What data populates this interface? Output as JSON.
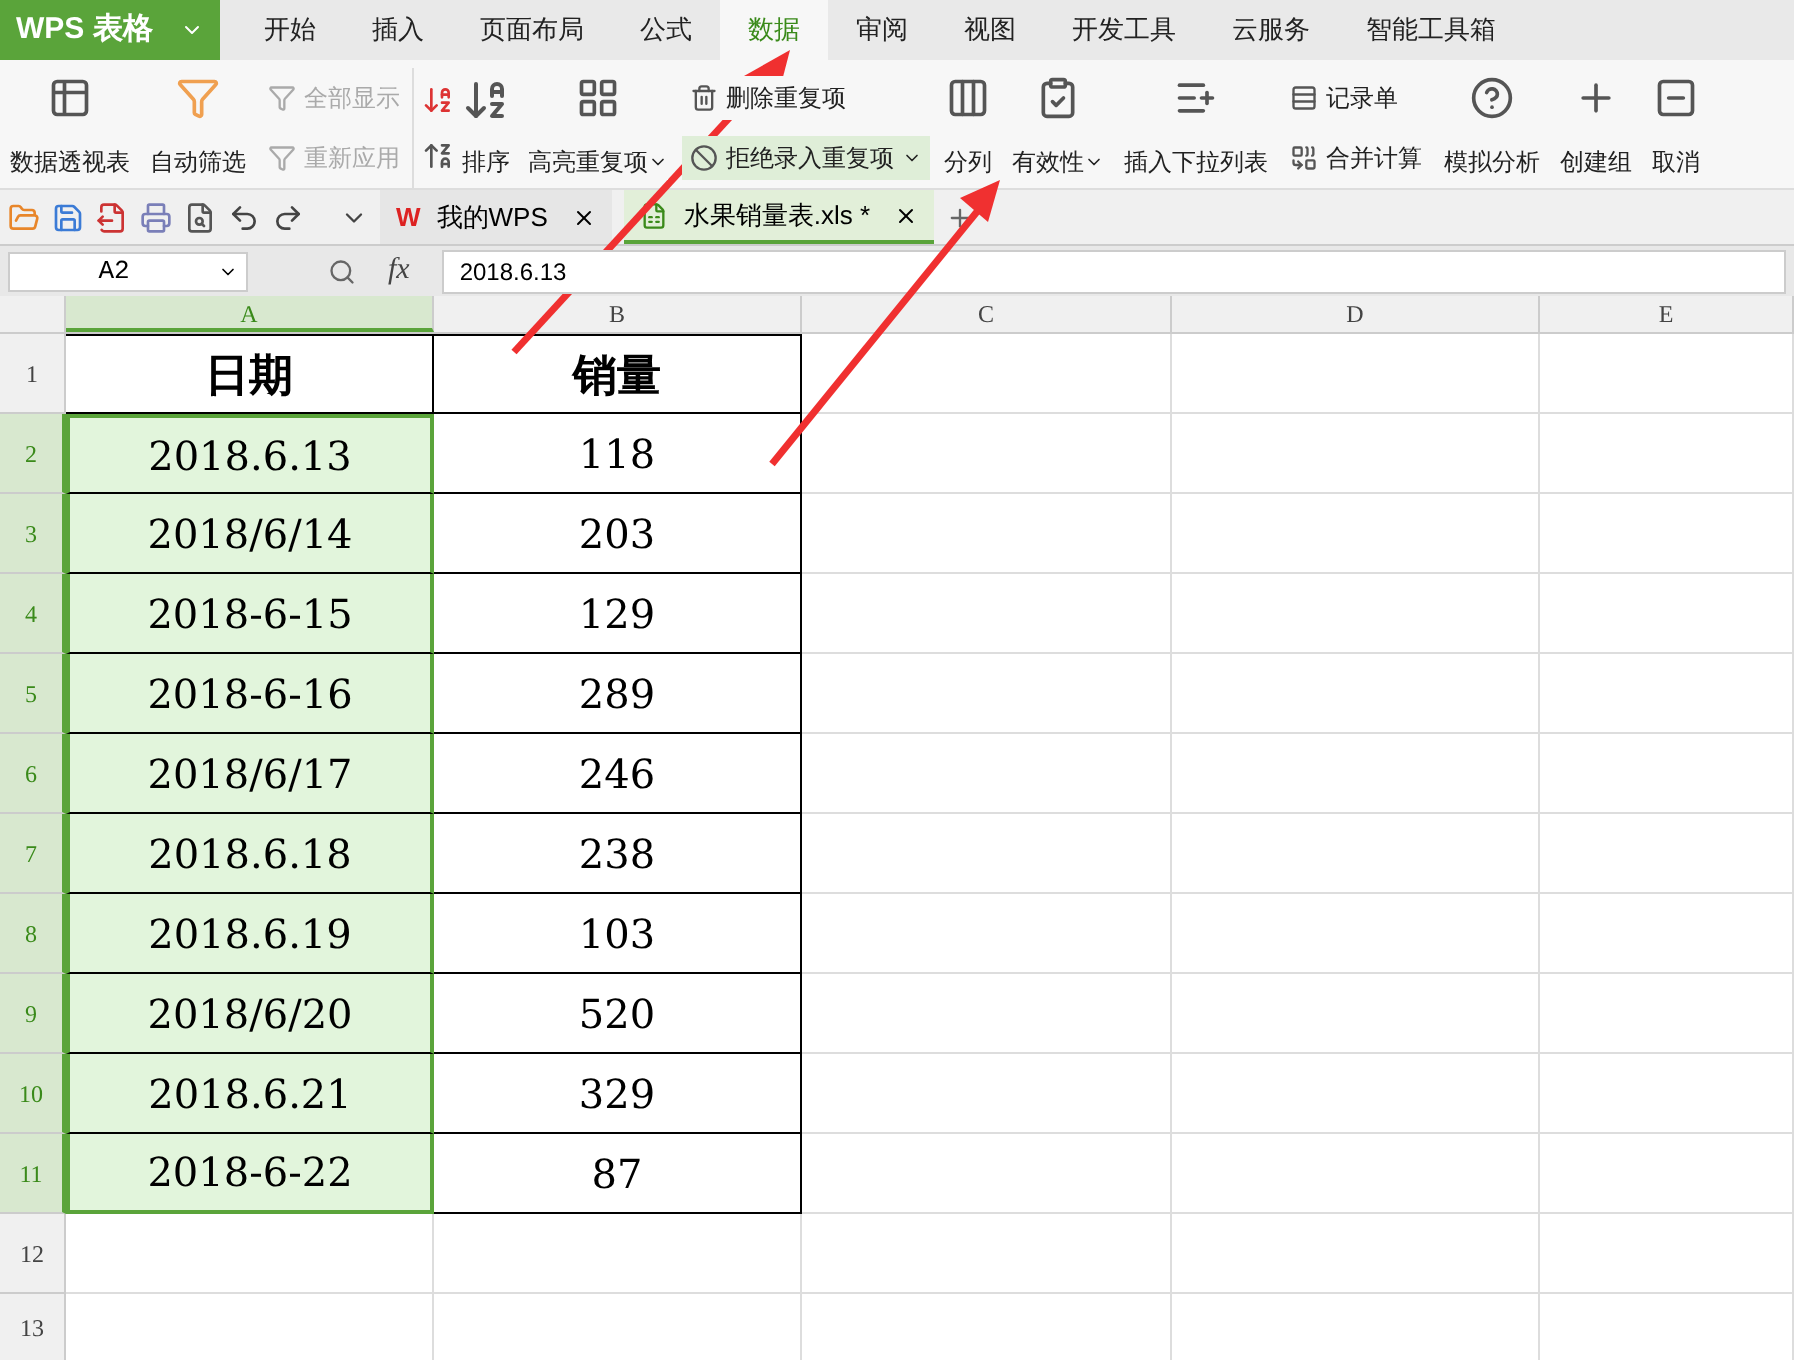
{
  "app_menu": {
    "label": "WPS 表格"
  },
  "menu_tabs": [
    {
      "label": "开始",
      "selected": false
    },
    {
      "label": "插入",
      "selected": false
    },
    {
      "label": "页面布局",
      "selected": false
    },
    {
      "label": "公式",
      "selected": false
    },
    {
      "label": "数据",
      "selected": true
    },
    {
      "label": "审阅",
      "selected": false
    },
    {
      "label": "视图",
      "selected": false
    },
    {
      "label": "开发工具",
      "selected": false
    },
    {
      "label": "云服务",
      "selected": false
    },
    {
      "label": "智能工具箱",
      "selected": false
    }
  ],
  "ribbon": [
    {
      "kind": "large",
      "label": "数据透视表",
      "dropdown": false
    },
    {
      "kind": "large",
      "label": "自动筛选",
      "dropdown": false
    },
    {
      "kind": "stack",
      "items": [
        {
          "label": "全部显示",
          "disabled": true,
          "dropdown": false,
          "highlighted": false
        },
        {
          "label": "重新应用",
          "disabled": true,
          "dropdown": false,
          "highlighted": false
        }
      ]
    },
    {
      "kind": "sort",
      "label": "排序"
    },
    {
      "kind": "large",
      "label": "高亮重复项",
      "dropdown": true
    },
    {
      "kind": "stack",
      "items": [
        {
          "label": "删除重复项",
          "disabled": false,
          "dropdown": false,
          "highlighted": false
        },
        {
          "label": "拒绝录入重复项",
          "disabled": false,
          "dropdown": true,
          "highlighted": true
        }
      ]
    },
    {
      "kind": "large",
      "label": "分列",
      "dropdown": false
    },
    {
      "kind": "large",
      "label": "有效性",
      "dropdown": true
    },
    {
      "kind": "large",
      "label": "插入下拉列表",
      "dropdown": false
    },
    {
      "kind": "stack",
      "items": [
        {
          "label": "记录单",
          "disabled": false,
          "dropdown": false,
          "highlighted": false
        },
        {
          "label": "合并计算",
          "disabled": false,
          "dropdown": false,
          "highlighted": false
        }
      ]
    },
    {
      "kind": "large",
      "label": "模拟分析",
      "dropdown": false
    },
    {
      "kind": "large",
      "label": "创建组",
      "dropdown": false
    },
    {
      "kind": "large",
      "label": "取消",
      "dropdown": false
    }
  ],
  "doc_tabs": [
    {
      "label": "我的WPS",
      "selected": false,
      "logo": "W"
    },
    {
      "label": "水果销量表.xls *",
      "selected": true
    }
  ],
  "formula_bar": {
    "name_box": "A2",
    "fx_label": "fx",
    "formula": "2018.6.13"
  },
  "sheet": {
    "columns": [
      {
        "label": "A",
        "selected": true
      },
      {
        "label": "B",
        "selected": false
      },
      {
        "label": "C",
        "selected": false
      },
      {
        "label": "D",
        "selected": false
      },
      {
        "label": "E",
        "selected": false
      }
    ],
    "rows": [
      {
        "label": "1",
        "selected": false,
        "cells": [
          "日期",
          "销量"
        ]
      },
      {
        "label": "2",
        "selected": true,
        "cells": [
          "2018.6.13",
          "118"
        ]
      },
      {
        "label": "3",
        "selected": true,
        "cells": [
          "2018/6/14",
          "203"
        ]
      },
      {
        "label": "4",
        "selected": true,
        "cells": [
          "2018-6-15",
          "129"
        ]
      },
      {
        "label": "5",
        "selected": true,
        "cells": [
          "2018-6-16",
          "289"
        ]
      },
      {
        "label": "6",
        "selected": true,
        "cells": [
          "2018/6/17",
          "246"
        ]
      },
      {
        "label": "7",
        "selected": true,
        "cells": [
          "2018.6.18",
          "238"
        ]
      },
      {
        "label": "8",
        "selected": true,
        "cells": [
          "2018.6.19",
          "103"
        ]
      },
      {
        "label": "9",
        "selected": true,
        "cells": [
          "2018/6/20",
          "520"
        ]
      },
      {
        "label": "10",
        "selected": true,
        "cells": [
          "2018.6.21",
          "329"
        ]
      },
      {
        "label": "11",
        "selected": true,
        "cells": [
          "2018-6-22",
          "87"
        ]
      },
      {
        "label": "12",
        "selected": false,
        "cells": []
      },
      {
        "label": "13",
        "selected": false,
        "cells": []
      }
    ]
  }
}
